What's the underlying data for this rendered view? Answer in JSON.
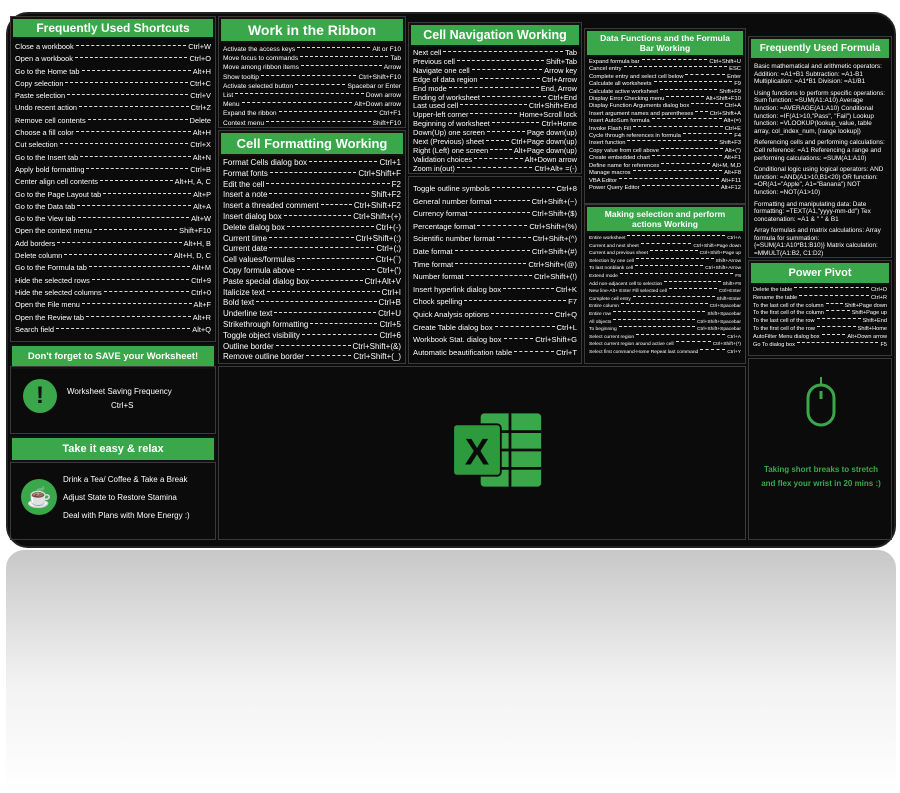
{
  "accent": "#3aa84a",
  "shortcuts": {
    "title": "Frequently Used Shortcuts",
    "items": [
      [
        "Close a workbook",
        "Ctrl+W"
      ],
      [
        "Open a workbook",
        "Ctrl+O"
      ],
      [
        "Go to the Home tab",
        "Alt+H"
      ],
      [
        "Copy selection",
        "Ctrl+C"
      ],
      [
        "Paste selection",
        "Ctrl+V"
      ],
      [
        "Undo recent action",
        "Ctrl+Z"
      ],
      [
        "Remove cell contents",
        "Delete"
      ],
      [
        "Choose a fill color",
        "Alt+H"
      ],
      [
        "Cut selection",
        "Ctrl+X"
      ],
      [
        "Go to the Insert tab",
        "Alt+N"
      ],
      [
        "Apply bold formatting",
        "Ctrl+B"
      ],
      [
        "Center align cell contents",
        "Alt+H, A, C"
      ],
      [
        "Go to the Page Layout tab",
        "Alt+P"
      ],
      [
        "Go to the Data tab",
        "Alt+A"
      ],
      [
        "Go to the View tab",
        "Alt+W"
      ],
      [
        "Open the context menu",
        "Shift+F10"
      ],
      [
        "Add borders",
        "Alt+H, B"
      ],
      [
        "Delete column",
        "Alt+H, D, C"
      ],
      [
        "Go to the Formula tab",
        "Alt+M"
      ],
      [
        "Hide the selected rows",
        "Ctrl+9"
      ],
      [
        "Hide the selected columns",
        "Ctrl+0"
      ],
      [
        "Open the File menu",
        "Alt+F"
      ],
      [
        "Open the Review tab",
        "Alt+R"
      ],
      [
        "Search field",
        "Alt+Q"
      ]
    ]
  },
  "save": {
    "title": "Don't forget to SAVE your Worksheet!",
    "line1": "Worksheet Saving Frequency",
    "line2": "Ctrl+S",
    "icon": "exclamation-icon"
  },
  "relax": {
    "title": "Take it easy & relax",
    "lines": [
      "Drink a Tea/ Coffee & Take a Break",
      "Adjust State to Restore Stamina",
      "Deal with Plans with More Energy :)"
    ],
    "icon": "coffee-cup-icon"
  },
  "ribbon": {
    "title": "Work in the Ribbon",
    "items": [
      [
        "Activate the access keys",
        "Alt or F10"
      ],
      [
        "Move focus to commands",
        "Tab"
      ],
      [
        "Move among ribbon items",
        "Arrow"
      ],
      [
        "Show tooltip",
        "Ctrl+Shift+F10"
      ],
      [
        "Activate selected button",
        "Spacebar or Enter"
      ],
      [
        "List",
        "Down arrow"
      ],
      [
        "Menu",
        "Alt+Down arrow"
      ],
      [
        "Expand the ribbon",
        "Ctrl+F1"
      ],
      [
        "Context menu",
        "Shift+F10"
      ]
    ]
  },
  "formatting": {
    "title": "Cell Formatting Working",
    "items": [
      [
        "Format Cells dialog box",
        "Ctrl+1"
      ],
      [
        "Format fonts",
        "Ctrl+Shift+F"
      ],
      [
        "Edit the cell",
        "F2"
      ],
      [
        "Insert a note",
        "Shift+F2"
      ],
      [
        "Insert a threaded comment",
        "Ctrl+Shift+F2"
      ],
      [
        "Insert dialog box",
        "Ctrl+Shift+(+)"
      ],
      [
        "Delete dialog box",
        "Ctrl+(-)"
      ],
      [
        "Current time",
        "Ctrl+Shift+(:)"
      ],
      [
        "Current date",
        "Ctrl+(;)"
      ],
      [
        "Cell values/formulas",
        "Ctrl+(`)"
      ],
      [
        "Copy formula above",
        "Ctrl+(')"
      ],
      [
        "Paste special dialog box",
        "Ctrl+Alt+V"
      ],
      [
        "Italicize text",
        "Ctrl+I"
      ],
      [
        "Bold text",
        "Ctrl+B"
      ],
      [
        "Underline text",
        "Ctrl+U"
      ],
      [
        "Strikethrough formatting",
        "Ctrl+5"
      ],
      [
        "Toggle object visibility",
        "Ctrl+6"
      ],
      [
        "Outline border",
        "Ctrl+Shift+(&)"
      ],
      [
        "Remove outline border",
        "Ctrl+Shift+(_)"
      ]
    ]
  },
  "navigation": {
    "title": "Cell Navigation Working",
    "items": [
      [
        "Next cell",
        "Tab"
      ],
      [
        "Previous cell",
        "Shift+Tab"
      ],
      [
        "Navigate one cell",
        "Arrow key"
      ],
      [
        "Edge of data region",
        "Ctrl+Arrow"
      ],
      [
        "End mode",
        "End, Arrow"
      ],
      [
        "Ending of worksheet",
        "Ctrl+End"
      ],
      [
        "Last used cell",
        "Ctrl+Shift+End"
      ],
      [
        "Upper-left corner",
        "Home+Scroll lock"
      ],
      [
        "Beginning of worksheet",
        "Ctrl+Home"
      ],
      [
        "Down(Up) one screen",
        "Page down(up)"
      ],
      [
        "Next (Previous) sheet",
        "Ctrl+Page down(up)"
      ],
      [
        "Right (Left) one screen",
        "Alt+Page down(up)"
      ],
      [
        "Validation choices",
        "Alt+Down arrow"
      ],
      [
        "Zoom in(out)",
        "Ctrl+Alt+ =(-)"
      ]
    ]
  },
  "numformat": {
    "items": [
      [
        "Toggle outline symbols",
        "Ctrl+8"
      ],
      [
        "General number format",
        "Ctrl+Shift+(~)"
      ],
      [
        "Currency format",
        "Ctrl+Shift+($)"
      ],
      [
        "Percentage format",
        "Ctrl+Shift+(%)"
      ],
      [
        "Scientific number format",
        "Ctrl+Shift+(^)"
      ],
      [
        "Date format",
        "Ctrl+Shift+(#)"
      ],
      [
        "Time format",
        "Ctrl+Shift+(@)"
      ],
      [
        "Number format",
        "Ctrl+Shift+(!)"
      ],
      [
        "Insert hyperlink dialog box",
        "Ctrl+K"
      ],
      [
        "Chock spelling",
        "F7"
      ],
      [
        "Quick Analysis options",
        "Ctrl+Q"
      ],
      [
        "Create Table dialog box",
        "Ctrl+L"
      ],
      [
        "Workbook Stat. dialog box",
        "Ctrl+Shift+G"
      ],
      [
        "Automatic beautification table",
        "Ctrl+T"
      ]
    ]
  },
  "datafunc": {
    "title": "Data Functions and the Formula Bar Working",
    "items": [
      [
        "Expand formula bar",
        "Ctrl+Shift+U"
      ],
      [
        "Cancel entry",
        "ESC"
      ],
      [
        "Complete entry and select cell below",
        "Enter"
      ],
      [
        "Calculate all worksheets",
        "F9"
      ],
      [
        "Calculate active worksheet",
        "Shift+F9"
      ],
      [
        "Display Error Checking menu",
        "Alt+Shift+F10"
      ],
      [
        "Display Function Arguments dialog box",
        "Ctrl+A"
      ],
      [
        "Insert argument names and parentheses",
        "Ctrl+Shift+A"
      ],
      [
        "Insert AutoSum formula",
        "Alt+(=)"
      ],
      [
        "Invoke Flash Fill",
        "Ctrl+E"
      ],
      [
        "Cycle through references in formula",
        "F4"
      ],
      [
        "Insert function",
        "Shift+F3"
      ],
      [
        "Copy value from cell above",
        "Alt+(\")"
      ],
      [
        "Create embedded chart",
        "Alt+F1"
      ],
      [
        "Define name for references",
        "Alt+M, M,D"
      ],
      [
        "Manage macros",
        "Alt+F8"
      ],
      [
        "VBA Editor",
        "Alt+F11"
      ],
      [
        "Power Query Editor",
        "Alt+F12"
      ]
    ]
  },
  "selection": {
    "title": "Making selection and perform actions Working",
    "items": [
      [
        "Entire worksheet",
        "Ctrl+A"
      ],
      [
        "Current and next sheet",
        "Ctrl+Shift+Page down"
      ],
      [
        "Current and previous sheet",
        "Ctrl+Shift+Page up"
      ],
      [
        "Selection by one cell",
        "Shift+Arrow"
      ],
      [
        "To last nonblank cell",
        "Ctrl+Shift+Arrow"
      ],
      [
        "Extend mode",
        "F8"
      ],
      [
        "Add non-adjacent cell to selection",
        "Shift+F8"
      ],
      [
        "New line-Alt+ Enter Fill selected cell",
        "Ctrl+Enter"
      ],
      [
        "Complete cell entry",
        "Shift+Enter"
      ],
      [
        "Entire column",
        "Ctrl+Spacebar"
      ],
      [
        "Entire row",
        "Shift+Spacebar"
      ],
      [
        "All objects",
        "Ctrl+Shift+Spacebar"
      ],
      [
        "To beginning",
        "Ctrl+Shift+Spacebar"
      ],
      [
        "Select current region",
        "Ctrl+A"
      ],
      [
        "Select current region around active cell",
        "Ctrl+Shift+(*)"
      ],
      [
        "Select first command-Home   Repeat last command",
        "Ctrl+Y"
      ]
    ]
  },
  "formula": {
    "title": "Frequently Used Formula",
    "paragraphs": [
      "Basic mathematical and arithmetic operators: Addition: =A1+B1   Subtraction: =A1-B1 Multiplication: =A1*B1 Division: =A1/B1",
      "Using functions to perform specific operations: Sum function: =SUM(A1:A10) Average function: =AVERAGE(A1:A10) Conditional function: =IF(A1>10,\"Pass\", \"Fail\") Lookup function: =VLOOKUP(lookup_value, table array, col_index_num, [range lookup])",
      "Referencing cells and performing calculations: Cell reference: =A1 Referencing a range and performing calculations: =SUM(A1:A10)",
      "Conditional logic using logical operators: AND function: =AND(A1>10,B1<20) OR function: =OR(A1=\"Apple\", A1=\"Banana\") NOT function: =NOT(A1>10)",
      "Formatting and manipulating data: Date formatting: =TEXT(A1,\"yyyy-mm-dd\") Tex concatenation: =A1 & \" \" & B1",
      "Array formulas and matrix calculations: Array formula for summation: {=SUM(A1:A10*B1:B10)} Matrix calculation: =MMULT(A1:B2, C1:D2)"
    ]
  },
  "pivot": {
    "title": "Power Pivot",
    "items": [
      [
        "Delete the table",
        "Ctrl+D"
      ],
      [
        "Rename the table",
        "Ctrl+R"
      ],
      [
        "To the last cell of the column",
        "Shift+Page down"
      ],
      [
        "To the first cell of the column",
        "Shift+Page up"
      ],
      [
        "To the last cell of the row",
        "Shift+End"
      ],
      [
        "To the first cell of the row",
        "Shift+Home"
      ],
      [
        "AutoFilter Menu dialog box",
        "Alt+Down arrow"
      ],
      [
        "Go To dialog box",
        "F5"
      ]
    ]
  },
  "breaks": {
    "text": "Taking short breaks to stretch and flex your wrist in 20 mins :)",
    "icon": "mouse-icon"
  },
  "logo": {
    "letter": "X",
    "icon": "excel-logo-icon"
  }
}
